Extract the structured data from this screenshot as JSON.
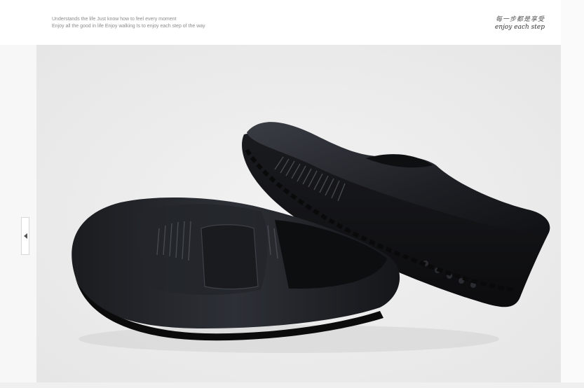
{
  "header": {
    "slogan_line1": "Understands the life  Just know how to feel every moment",
    "slogan_line2": "Enjoy all the good in life   Enjoy walking   Is to enjoy each step of the way",
    "brand_cn": "每一步都是享受",
    "brand_en": "enjoy each step"
  },
  "product": {
    "image_icon": "loafer-shoes-photo"
  },
  "navigation": {
    "prev_icon": "left-arrow-icon"
  }
}
